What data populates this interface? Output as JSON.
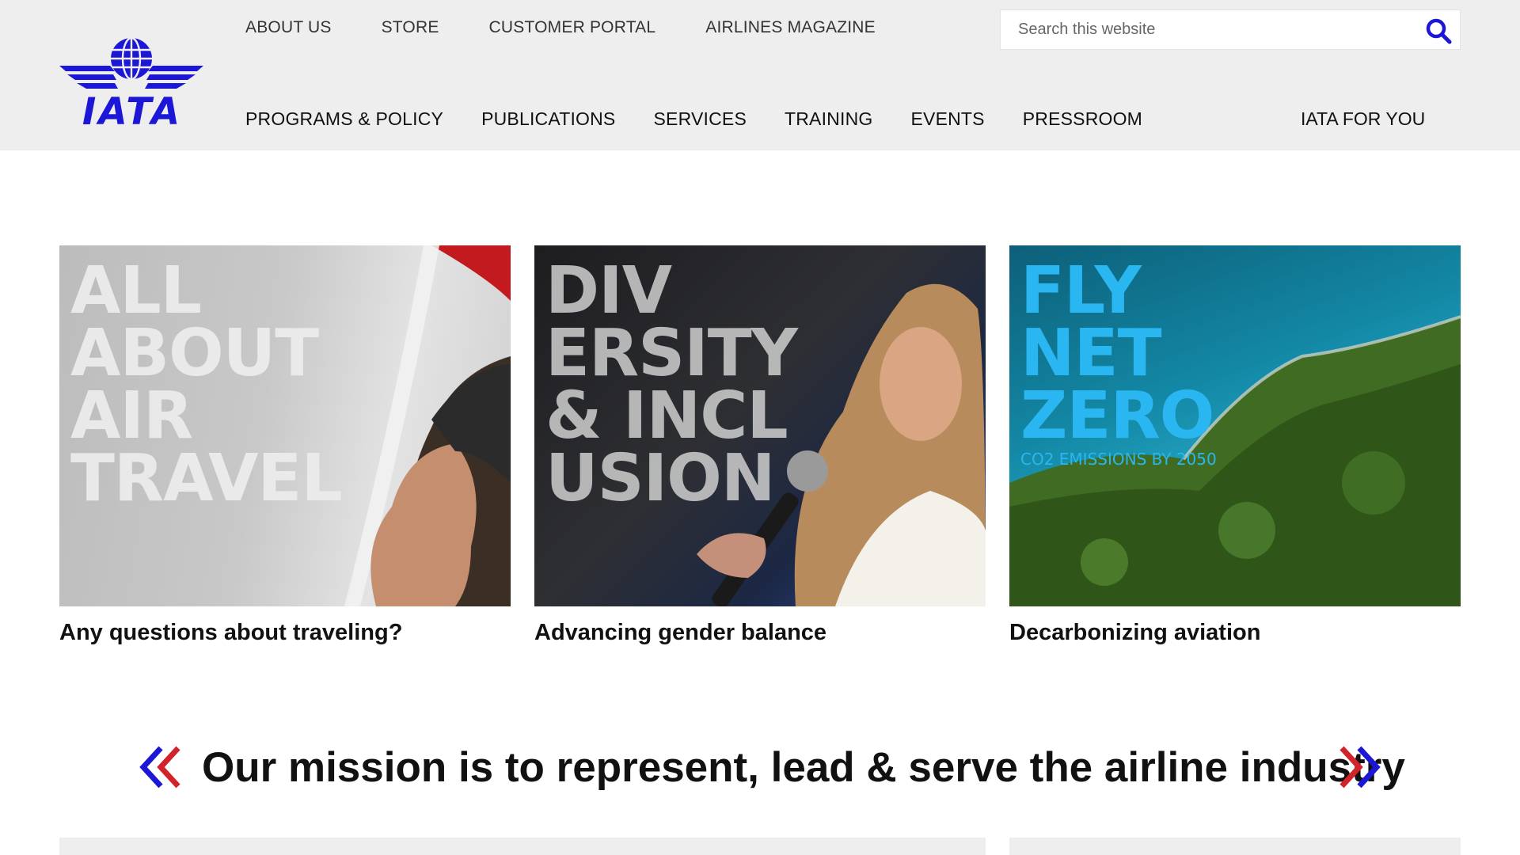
{
  "brand": {
    "logo_text": "IATA",
    "colors": {
      "brand_blue": "#1c17d6",
      "accent_red": "#d2232a",
      "header_bg": "#eeeeee"
    }
  },
  "top_nav": {
    "items": [
      {
        "label": "ABOUT US"
      },
      {
        "label": "STORE"
      },
      {
        "label": "CUSTOMER PORTAL"
      },
      {
        "label": "AIRLINES MAGAZINE"
      }
    ]
  },
  "search": {
    "placeholder": "Search this website",
    "value": "",
    "icon": "search-icon"
  },
  "main_nav": {
    "items": [
      {
        "label": "PROGRAMS & POLICY"
      },
      {
        "label": "PUBLICATIONS"
      },
      {
        "label": "SERVICES"
      },
      {
        "label": "TRAINING"
      },
      {
        "label": "EVENTS"
      },
      {
        "label": "PRESSROOM"
      }
    ],
    "right_label": "IATA FOR YOU"
  },
  "cards": [
    {
      "overlay_lines": [
        "ALL",
        "ABOUT",
        "AIR",
        "TRAVEL"
      ],
      "caption": "Any questions about traveling?"
    },
    {
      "overlay_lines": [
        "DIV",
        "ERSITY",
        "& INCL",
        "USION"
      ],
      "caption": "Advancing gender balance"
    },
    {
      "overlay_lines": [
        "FLY",
        "NET",
        "ZERO"
      ],
      "overlay_sub": "CO2 EMISSIONS BY 2050",
      "caption": "Decarbonizing aviation"
    }
  ],
  "mission": {
    "text": "Our mission is to represent, lead & serve the airline industry"
  }
}
